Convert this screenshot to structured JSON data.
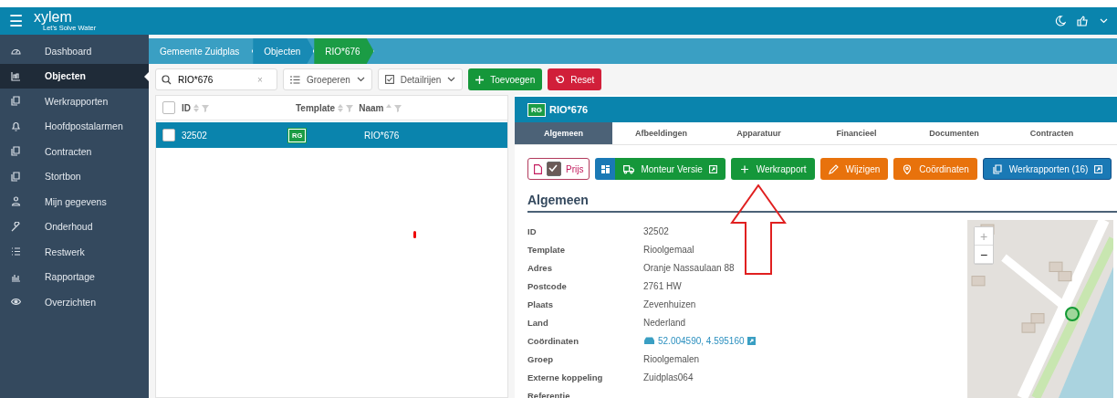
{
  "app": {
    "logo": "xylem",
    "tagline": "Let's Solve Water",
    "menu_glyph": "☰"
  },
  "sidebar": {
    "items": [
      {
        "label": "Dashboard",
        "selected": false
      },
      {
        "label": "Objecten",
        "selected": true
      },
      {
        "label": "Werkrapporten",
        "selected": false
      },
      {
        "label": "Hoofdpostalarmen",
        "selected": false
      },
      {
        "label": "Contracten",
        "selected": false
      },
      {
        "label": "Stortbon",
        "selected": false
      },
      {
        "label": "Mijn gegevens",
        "selected": false
      },
      {
        "label": "Onderhoud",
        "selected": false
      },
      {
        "label": "Restwerk",
        "selected": false
      },
      {
        "label": "Rapportage",
        "selected": false
      },
      {
        "label": "Overzichten",
        "selected": false
      }
    ]
  },
  "breadcrumbs": [
    {
      "label": "Gemeente Zuidplas",
      "selected": false
    },
    {
      "label": "Objecten",
      "selected": false
    },
    {
      "label": "RIO*676",
      "selected": true
    }
  ],
  "toolbar": {
    "search": {
      "value": "RIO*676",
      "clear": "×"
    },
    "group_button": "Groeperen",
    "detail_button": "Detailrijen",
    "add_button": "Toevoegen",
    "reset_button": "Reset"
  },
  "table": {
    "select_all_checked": false,
    "columns": [
      "ID",
      "Template",
      "Naam"
    ],
    "rows": [
      {
        "id": "32502",
        "template": "RG",
        "name": "RIO*676",
        "selected": true,
        "checked": false
      }
    ]
  },
  "detail": {
    "badge": "RG",
    "title": "RIO*676",
    "tabs": [
      {
        "label": "Algemeen",
        "selected": true
      },
      {
        "label": "Afbeeldingen",
        "selected": false
      },
      {
        "label": "Apparatuur",
        "selected": false
      },
      {
        "label": "Financieel",
        "selected": false
      },
      {
        "label": "Documenten",
        "selected": false
      },
      {
        "label": "Contracten",
        "selected": false
      }
    ],
    "price_toggle": {
      "label": "Prijs",
      "checked": true
    },
    "actions": [
      {
        "label": "Monteur Versie",
        "kind": "monteur",
        "external": true
      },
      {
        "label": "Werkrapport",
        "kind": "add",
        "external": false
      },
      {
        "label": "Wijzigen",
        "kind": "edit",
        "external": false
      },
      {
        "label": "Coördinaten",
        "kind": "location",
        "external": false
      },
      {
        "label": "Werkrapporten (16)",
        "kind": "reports",
        "external": true
      }
    ],
    "section_title": "Algemeen",
    "fields": [
      {
        "label": "ID",
        "value": "32502",
        "kind": "text"
      },
      {
        "label": "Template",
        "value": "Rioolgemaal",
        "kind": "text"
      },
      {
        "label": "Adres",
        "value": "Oranje Nassaulaan 88",
        "kind": "text"
      },
      {
        "label": "Postcode",
        "value": "2761 HW",
        "kind": "text"
      },
      {
        "label": "Plaats",
        "value": "Zevenhuizen",
        "kind": "text"
      },
      {
        "label": "Land",
        "value": "Nederland",
        "kind": "text"
      },
      {
        "label": "Coördinaten",
        "value": "52.004590, 4.595160",
        "kind": "link"
      },
      {
        "label": "Groep",
        "value": "Rioolgemalen",
        "kind": "text"
      },
      {
        "label": "Externe koppeling",
        "value": "Zuidplas064",
        "kind": "text"
      },
      {
        "label": "Referentie",
        "kind": "text"
      }
    ],
    "map": {
      "zoom_in": "+",
      "zoom_out": "−"
    }
  }
}
